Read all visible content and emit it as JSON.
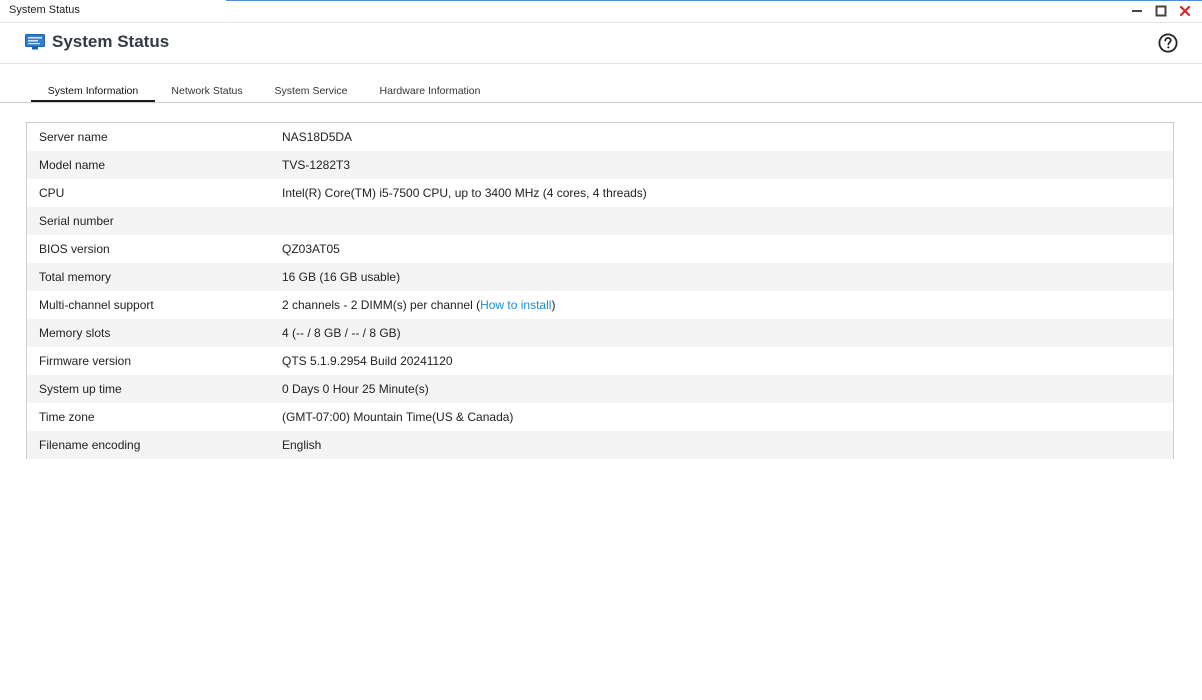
{
  "window": {
    "title": "System Status"
  },
  "header": {
    "title": "System Status",
    "app_icon": "monitor-icon",
    "help_icon": "help-circle-icon"
  },
  "tabs": [
    {
      "label": "System Information",
      "active": true
    },
    {
      "label": "Network Status",
      "active": false
    },
    {
      "label": "System Service",
      "active": false
    },
    {
      "label": "Hardware Information",
      "active": false
    }
  ],
  "info": {
    "rows": [
      {
        "label": "Server name",
        "value": "NAS18D5DA"
      },
      {
        "label": "Model name",
        "value": "TVS-1282T3"
      },
      {
        "label": "CPU",
        "value": "Intel(R) Core(TM) i5-7500 CPU, up to 3400 MHz (4 cores, 4 threads)"
      },
      {
        "label": "Serial number",
        "value": ""
      },
      {
        "label": "BIOS version",
        "value": "QZ03AT05"
      },
      {
        "label": "Total memory",
        "value": "16 GB (16 GB usable)"
      },
      {
        "label": "Multi-channel support",
        "value_prefix": "2 channels - 2 DIMM(s) per channel (",
        "link": "How to install",
        "value_suffix": ")"
      },
      {
        "label": "Memory slots",
        "value": "4 (-- / 8 GB / -- / 8 GB)"
      },
      {
        "label": "Firmware version",
        "value": "QTS 5.1.9.2954 Build 20241120"
      },
      {
        "label": "System up time",
        "value": "0 Days 0 Hour 25 Minute(s)"
      },
      {
        "label": "Time zone",
        "value": "(GMT-07:00) Mountain Time(US & Canada)"
      },
      {
        "label": "Filename encoding",
        "value": "English"
      }
    ]
  },
  "colors": {
    "link": "#1c8fd6",
    "close": "#d9262b",
    "accent": "#4a90d9"
  }
}
